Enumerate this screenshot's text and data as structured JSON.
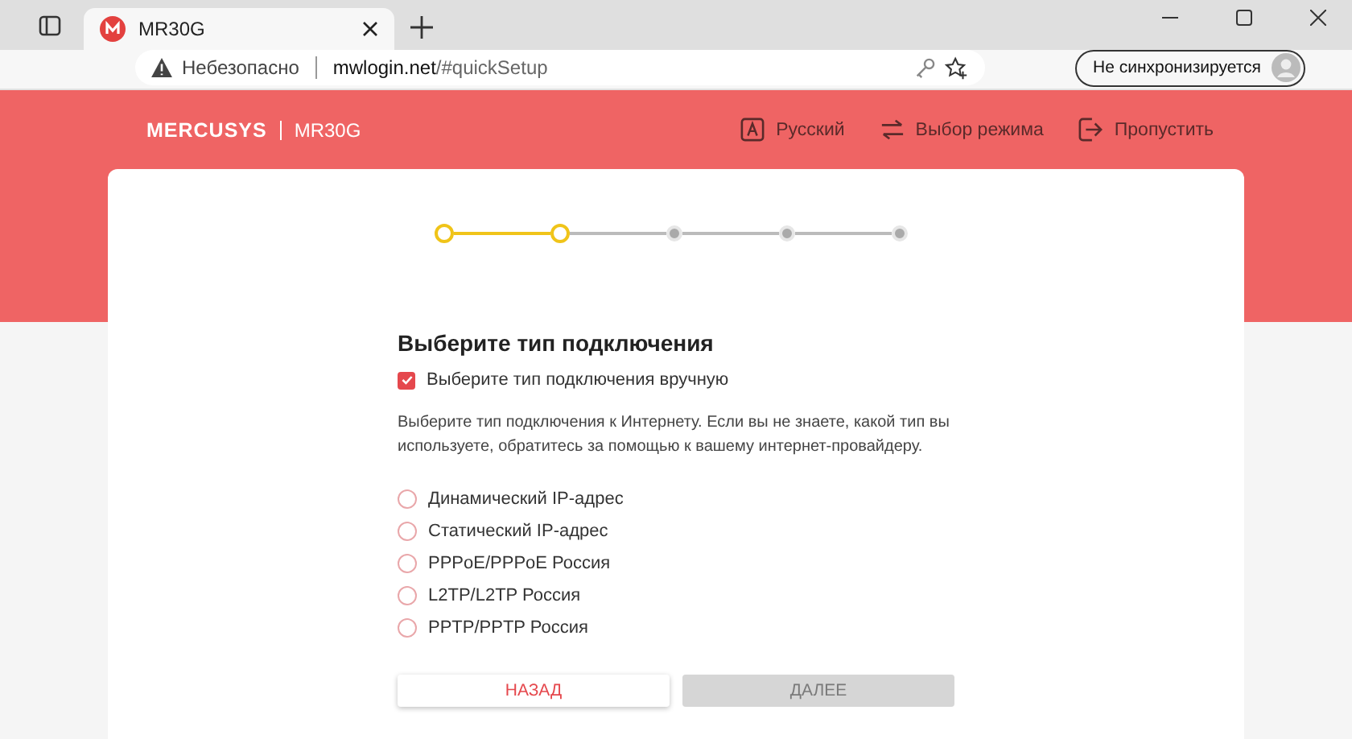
{
  "browser": {
    "tab_title": "MR30G",
    "security_label": "Небезопасно",
    "url_host": "mwlogin.net",
    "url_path": "/#quickSetup",
    "sync_label": "Не синхронизируется"
  },
  "header": {
    "brand": "MERCUSYS",
    "model": "MR30G",
    "links": [
      {
        "kind": "language",
        "label": "Русский"
      },
      {
        "kind": "mode",
        "label": "Выбор режима"
      },
      {
        "kind": "skip",
        "label": "Пропустить"
      }
    ]
  },
  "steps": [
    {
      "active": true
    },
    {
      "active": true
    },
    {
      "active": false
    },
    {
      "active": false
    },
    {
      "active": false
    }
  ],
  "form": {
    "title": "Выберите тип подключения",
    "manual": {
      "label": "Выберите тип подключения вручную",
      "checked": true
    },
    "description": "Выберите тип подключения к Интернету. Если вы не знаете, какой тип вы используете, обратитесь за помощью к вашему интернет-провайдеру.",
    "options": [
      {
        "label": "Динамический IP-адрес",
        "selected": false
      },
      {
        "label": "Статический IP-адрес",
        "selected": false
      },
      {
        "label": "PPPoE/PPPoE Россия",
        "selected": false
      },
      {
        "label": "L2TP/L2TP Россия",
        "selected": false
      },
      {
        "label": "PPTP/PPTP Россия",
        "selected": false
      }
    ],
    "buttons": [
      {
        "kind": "back",
        "label": "НАЗАД",
        "disabled": false
      },
      {
        "kind": "next",
        "label": "ДАЛЕЕ",
        "disabled": true
      }
    ]
  }
}
